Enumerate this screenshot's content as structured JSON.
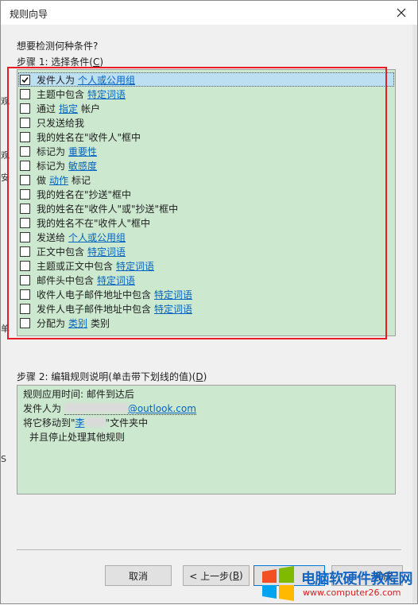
{
  "window": {
    "title": "规则向导"
  },
  "question": "想要检测何种条件?",
  "step1": {
    "label": "步骤 1: 选择条件(",
    "accel": "C",
    "close": ")"
  },
  "conditions": [
    {
      "text": "发件人为",
      "link": "个人或公用组",
      "suffix": "",
      "checked": true,
      "selected": true
    },
    {
      "text": "主题中包含",
      "link": "特定词语",
      "suffix": "",
      "checked": false
    },
    {
      "text": "通过",
      "link": "指定",
      "suffix": "帐户",
      "checked": false
    },
    {
      "text": "只发送给我",
      "link": "",
      "suffix": "",
      "checked": false
    },
    {
      "text": "我的姓名在\"收件人\"框中",
      "link": "",
      "suffix": "",
      "checked": false
    },
    {
      "text": "标记为",
      "link": "重要性",
      "suffix": "",
      "checked": false
    },
    {
      "text": "标记为",
      "link": "敏感度",
      "suffix": "",
      "checked": false
    },
    {
      "text": "做",
      "link": "动作",
      "suffix": "标记",
      "checked": false
    },
    {
      "text": "我的姓名在\"抄送\"框中",
      "link": "",
      "suffix": "",
      "checked": false
    },
    {
      "text": "我的姓名在\"收件人\"或\"抄送\"框中",
      "link": "",
      "suffix": "",
      "checked": false
    },
    {
      "text": "我的姓名不在\"收件人\"框中",
      "link": "",
      "suffix": "",
      "checked": false
    },
    {
      "text": "发送给",
      "link": "个人或公用组",
      "suffix": "",
      "checked": false
    },
    {
      "text": "正文中包含",
      "link": "特定词语",
      "suffix": "",
      "checked": false
    },
    {
      "text": "主题或正文中包含",
      "link": "特定词语",
      "suffix": "",
      "checked": false
    },
    {
      "text": "邮件头中包含",
      "link": "特定词语",
      "suffix": "",
      "checked": false
    },
    {
      "text": "收件人电子邮件地址中包含",
      "link": "特定词语",
      "suffix": "",
      "checked": false
    },
    {
      "text": "发件人电子邮件地址中包含",
      "link": "特定词语",
      "suffix": "",
      "checked": false
    },
    {
      "text": "分配为",
      "link": "类别",
      "suffix": "类别",
      "checked": false
    }
  ],
  "step2": {
    "label": "步骤 2: 编辑规则说明(单击带下划线的值)(",
    "accel": "D",
    "close": ")"
  },
  "description": {
    "line1": "规则应用时间: 邮件到达后",
    "line2_prefix": "发件人为",
    "line2_email_domain": "@outlook.com",
    "line3_prefix": "将它移动到\"",
    "line3_folder": "李",
    "line3_suffix": "\"文件夹中",
    "line4": "并且停止处理其他规则"
  },
  "buttons": {
    "cancel": "取消",
    "back": "< 上一步(",
    "back_accel": "B",
    "back_close": ")",
    "finish": "完成"
  },
  "left_fragments": [
    "观",
    "观",
    "安",
    "单",
    "S"
  ],
  "watermark": {
    "site_name": "电脑软硬件教程网",
    "url": "www.computer26.com"
  },
  "colors": {
    "list_bg": "#cce8cf",
    "highlight": "#e81c24",
    "link": "#0563c1"
  }
}
